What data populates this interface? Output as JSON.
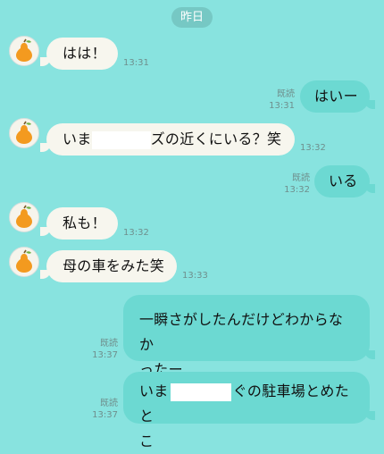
{
  "date_label": "昨日",
  "icons": {
    "avatar": "pear-icon"
  },
  "messages": [
    {
      "side": "in",
      "text": "はは！",
      "time": "13:31"
    },
    {
      "side": "out",
      "read": "既読",
      "time": "13:31",
      "text": "はいー"
    },
    {
      "side": "in",
      "text_before": "いま",
      "text_after": "ズの近くにいる？笑",
      "time": "13:32"
    },
    {
      "side": "out",
      "read": "既読",
      "time": "13:32",
      "text": "いる"
    },
    {
      "side": "in",
      "text": "私も！",
      "time": "13:32"
    },
    {
      "side": "in",
      "text": "母の車をみた笑",
      "time": "13:33"
    },
    {
      "side": "out",
      "read": "既読",
      "time": "13:37",
      "line1": "一瞬さがしたんだけどわからなか",
      "line2": "ったー"
    },
    {
      "side": "out",
      "read": "既読",
      "time": "13:37",
      "line1_before": "いま",
      "line1_after": "ぐの駐車場とめたと",
      "line2": "こ"
    }
  ],
  "colors": {
    "background": "#88e3df",
    "incoming": "#f7f6ee",
    "outgoing": "#6cd9d2"
  }
}
